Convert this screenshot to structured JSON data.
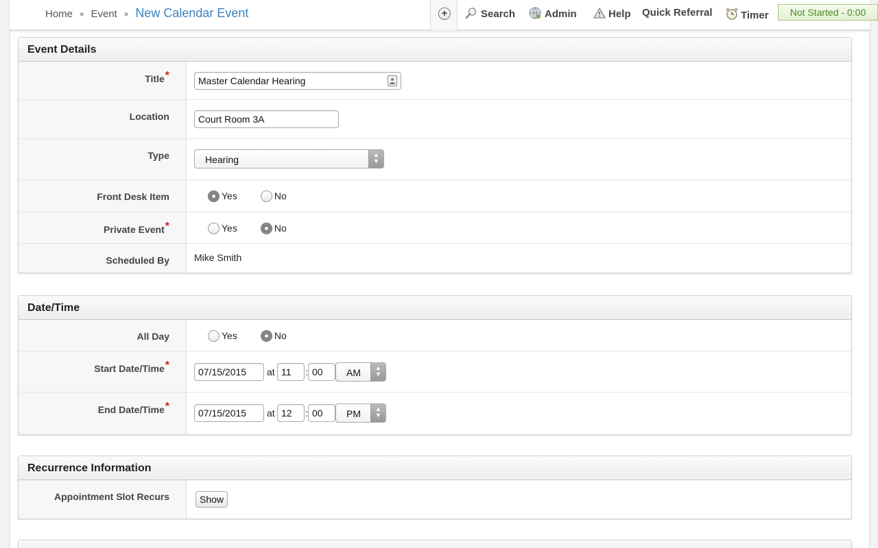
{
  "breadcrumb": {
    "items": [
      "Home",
      "Event"
    ],
    "separator": "»",
    "current": "New Calendar Event"
  },
  "topnav": {
    "add_icon": "plus-circle-icon",
    "items": [
      {
        "label": "Search",
        "icon": "magnifier-icon"
      },
      {
        "label": "Admin",
        "icon": "globe-gear-icon"
      },
      {
        "label": "Help",
        "icon": "warning-triangle-icon"
      },
      {
        "label": "Quick Referral",
        "icon": ""
      },
      {
        "label": "Timer",
        "icon": "alarm-clock-icon"
      }
    ],
    "timer_status": "Not Started - 0:00",
    "timer_color": "#4b8a1f"
  },
  "event_details": {
    "heading": "Event Details",
    "title_label": "Title",
    "title_value": "Master Calendar Hearing",
    "location_label": "Location",
    "location_value": "Court Room 3A",
    "type_label": "Type",
    "type_value": "Hearing",
    "front_desk_label": "Front Desk Item",
    "front_desk_options": [
      "Yes",
      "No"
    ],
    "front_desk_selected": "Yes",
    "private_label": "Private Event",
    "private_options": [
      "Yes",
      "No"
    ],
    "private_selected": "No",
    "scheduled_by_label": "Scheduled By",
    "scheduled_by_value": "Mike Smith"
  },
  "date_time": {
    "heading": "Date/Time",
    "all_day_label": "All Day",
    "all_day_options": [
      "Yes",
      "No"
    ],
    "all_day_selected": "No",
    "start_label": "Start Date/Time",
    "start_date": "07/15/2015",
    "start_hour": "11",
    "start_minute": "00",
    "start_ampm": "AM",
    "end_label": "End Date/Time",
    "end_date": "07/15/2015",
    "end_hour": "12",
    "end_minute": "00",
    "end_ampm": "PM",
    "at_text": "at",
    "colon_text": ":"
  },
  "recurrence": {
    "heading": "Recurrence Information",
    "slot_label": "Appointment Slot Recurs",
    "show_button": "Show"
  },
  "required_marker": "*",
  "accent_color": "#3b83c0",
  "required_color": "#d21b1b"
}
